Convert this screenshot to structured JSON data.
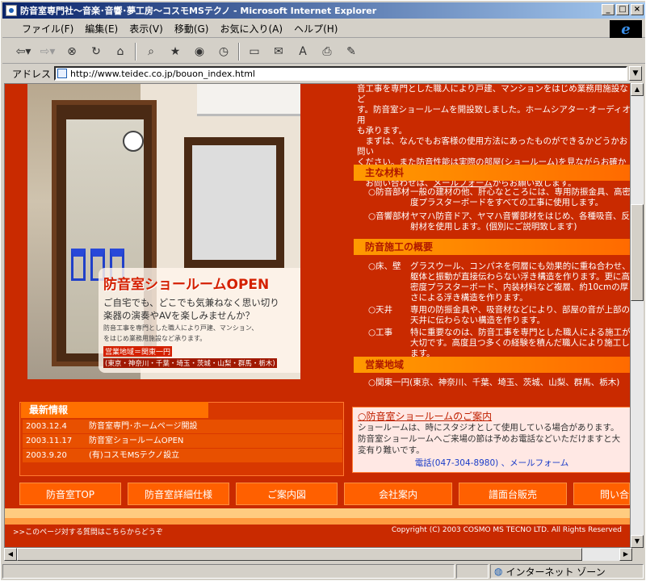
{
  "window": {
    "title": "防音室専門社～音楽･音響･夢工房～コスモMSテクノ - Microsoft Internet Explorer"
  },
  "menu": [
    "ファイル(F)",
    "編集(E)",
    "表示(V)",
    "移動(G)",
    "お気に入り(A)",
    "ヘルプ(H)"
  ],
  "address": {
    "label": "アドレス",
    "url": "http://www.teidec.co.jp/bouon_index.html"
  },
  "intro": {
    "lines": [
      "音工事を専門とした職人により戸建、マンションをはじめ業務用施設など",
      "す。防音室ショールームを開設致しました。ホームシアター･オーディオ用",
      "も承ります。",
      "　まずは、なんでもお客様の使用方法にあったものができるかどうかお問い",
      "ください。また防音性能は実際の部屋(ショールーム)を見ながらお確かめ",
      "　お問い合わせは、"
    ],
    "link": "メールフォーム",
    "suffix": "からお願い致します。"
  },
  "promo": {
    "heading": "防音室ショールームOPEN",
    "sub1": "ご自宅でも、どこでも気兼ねなく思い切り",
    "sub2": "楽器の演奏やAVを楽しみませんか？",
    "tiny1": "防音工事を専門とした職人により戸建、マンション、",
    "tiny2": "をはじめ業務用施設など承ります。",
    "area": "営業地域＝関東一円",
    "regions": "(東京・神奈川・千葉・埼玉・茨城・山梨・群馬・栃木)"
  },
  "materials": {
    "heading": "主な材料",
    "rows": [
      {
        "k": "○防音部材",
        "v": "一般の建材の他、肝心なところには、専用防振金具、高密度プラスターボードをすべての工事に使用します。"
      },
      {
        "k": "○音響部材",
        "v": "ヤマハ防音ドア、ヤマハ音響部材をはじめ、各種吸音、反射材を使用します。(個別にご説明致します)"
      }
    ]
  },
  "construction": {
    "heading": "防音施工の概要",
    "rows": [
      {
        "k": "○床、壁",
        "v": "グラスウール、コンパネを何層にも効果的に重ね合わせ、躯体と振動が直接伝わらない浮き構造を作ります。更に高密度プラスターボード、内装材料など複層、約10cmの厚さによる浮き構造を作ります。"
      },
      {
        "k": "○天井",
        "v": "専用の防振金具や、吸音材などにより、部屋の音が上部の天井に伝わらない構造を作ります。"
      },
      {
        "k": "○工事",
        "v": "特に重要なのは、防音工事を専門とした職人による施工が大切です。高度且つ多くの経験を積んだ職人により施工します。"
      }
    ]
  },
  "area": {
    "heading": "営業地域",
    "text": "○関東一円(東京、神奈川、千葉、埼玉、茨城、山梨、群馬、栃木)"
  },
  "news": {
    "heading": "最新情報",
    "items": [
      {
        "date": "2003.12.4",
        "text": "防音室専門･ホームページ開設"
      },
      {
        "date": "2003.11.17",
        "text": "防音室ショールームOPEN"
      },
      {
        "date": "2003.9.20",
        "text": "(有)コスモMSテクノ設立"
      }
    ]
  },
  "showroom": {
    "title": "○防音室ショールームのご案内",
    "body": "ショールームは、時にスタジオとして使用している場合があります。防音室ショールームへご来場の節は予めお電話などいただけますと大変有り難いです。",
    "contact": "電話(047-304-8980) 、メールフォーム"
  },
  "nav": [
    "防音室TOP",
    "防音室詳細仕様",
    "ご案内図",
    "会社案内",
    "譜面台販売",
    "問い合"
  ],
  "footer": {
    "left": ">>このページ対する質問はこちらからどうぞ",
    "right": "Copyright (C) 2003 COSMO MS TECNO LTD. All Rights Reserved"
  },
  "status": {
    "zone": "インターネット ゾーン"
  }
}
